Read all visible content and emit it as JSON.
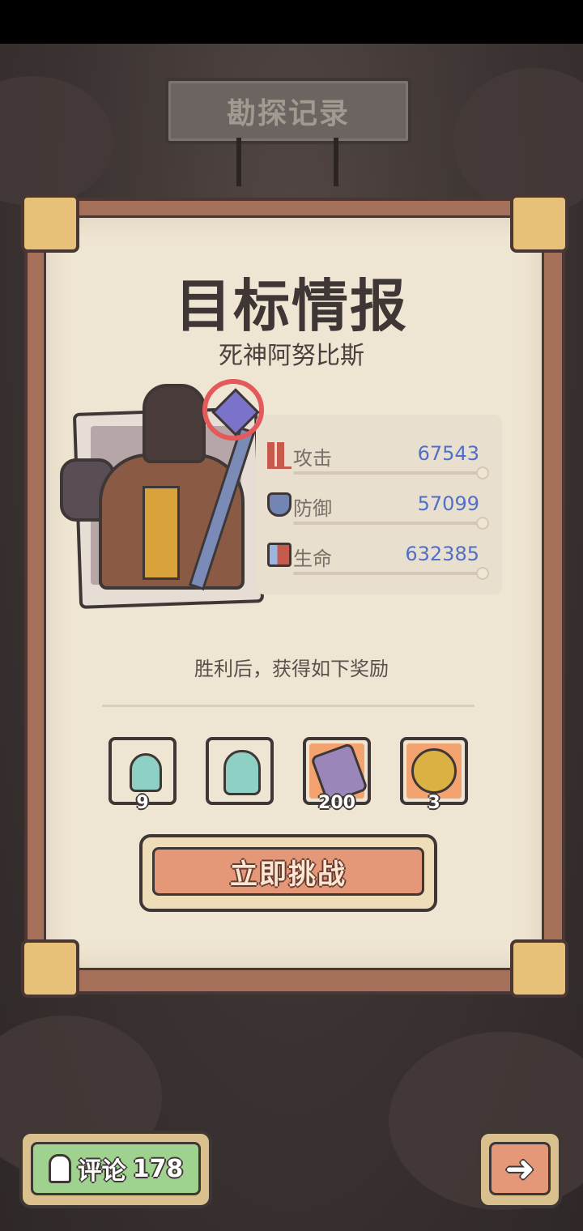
{
  "header": {
    "title": "勘探记录"
  },
  "panel": {
    "title": "目标情报",
    "target_name": "死神阿努比斯",
    "stats": [
      {
        "label": "攻击",
        "value": "67543",
        "icon": "attack-icon"
      },
      {
        "label": "防御",
        "value": "57099",
        "icon": "defense-icon"
      },
      {
        "label": "生命",
        "value": "632385",
        "icon": "health-icon"
      }
    ],
    "reward_text": "胜利后，获得如下奖励",
    "rewards": [
      {
        "icon": "small-ghost-icon",
        "count": "9",
        "bg": "#efe5d3"
      },
      {
        "icon": "ghost-icon",
        "count": "",
        "bg": "#efe5d3"
      },
      {
        "icon": "coffin-icon",
        "count": "200",
        "bg": "#f3a36f"
      },
      {
        "icon": "yin-yang-coin-icon",
        "count": "3",
        "bg": "#f3a36f"
      }
    ],
    "challenge_label": "立即挑战"
  },
  "footer": {
    "comment_label": "评论",
    "comment_count": "178",
    "next_icon": "arrow-right-icon"
  },
  "colors": {
    "stat_value": "#4f6fc9",
    "challenge_button": "#e49878",
    "comment_button": "#9fd28e"
  }
}
